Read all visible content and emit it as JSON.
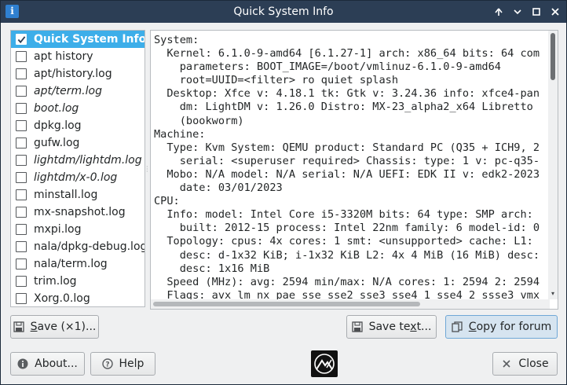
{
  "window": {
    "title": "Quick System Info",
    "app_icon_glyph": "i"
  },
  "file_list": {
    "items": [
      {
        "label": "Quick System Info",
        "checked": true,
        "selected": true,
        "italic": false
      },
      {
        "label": "apt history",
        "checked": false,
        "selected": false,
        "italic": false
      },
      {
        "label": "apt/history.log",
        "checked": false,
        "selected": false,
        "italic": false
      },
      {
        "label": "apt/term.log",
        "checked": false,
        "selected": false,
        "italic": true
      },
      {
        "label": "boot.log",
        "checked": false,
        "selected": false,
        "italic": true
      },
      {
        "label": "dpkg.log",
        "checked": false,
        "selected": false,
        "italic": false
      },
      {
        "label": "gufw.log",
        "checked": false,
        "selected": false,
        "italic": false
      },
      {
        "label": "lightdm/lightdm.log",
        "checked": false,
        "selected": false,
        "italic": true
      },
      {
        "label": "lightdm/x-0.log",
        "checked": false,
        "selected": false,
        "italic": true
      },
      {
        "label": "minstall.log",
        "checked": false,
        "selected": false,
        "italic": false
      },
      {
        "label": "mx-snapshot.log",
        "checked": false,
        "selected": false,
        "italic": false
      },
      {
        "label": "mxpi.log",
        "checked": false,
        "selected": false,
        "italic": false
      },
      {
        "label": "nala/dpkg-debug.log",
        "checked": false,
        "selected": false,
        "italic": false
      },
      {
        "label": "nala/term.log",
        "checked": false,
        "selected": false,
        "italic": false
      },
      {
        "label": "trim.log",
        "checked": false,
        "selected": false,
        "italic": false
      },
      {
        "label": "Xorg.0.log",
        "checked": false,
        "selected": false,
        "italic": false
      }
    ]
  },
  "info_text": "System:\n  Kernel: 6.1.0-9-amd64 [6.1.27-1] arch: x86_64 bits: 64 com\n    parameters: BOOT_IMAGE=/boot/vmlinuz-6.1.0-9-amd64\n    root=UUID=<filter> ro quiet splash\n  Desktop: Xfce v: 4.18.1 tk: Gtk v: 3.24.36 info: xfce4-pan\n    dm: LightDM v: 1.26.0 Distro: MX-23_alpha2_x64 Libretto\n    (bookworm)\nMachine:\n  Type: Kvm System: QEMU product: Standard PC (Q35 + ICH9, 2\n    serial: <superuser required> Chassis: type: 1 v: pc-q35-\n  Mobo: N/A model: N/A serial: N/A UEFI: EDK II v: edk2-2023\n    date: 03/01/2023\nCPU:\n  Info: model: Intel Core i5-3320M bits: 64 type: SMP arch:\n    built: 2012-15 process: Intel 22nm family: 6 model-id: 0\n  Topology: cpus: 4x cores: 1 smt: <unsupported> cache: L1:\n    desc: d-1x32 KiB; i-1x32 KiB L2: 4x 4 MiB (16 MiB) desc:\n    desc: 1x16 MiB\n  Speed (MHz): avg: 2594 min/max: N/A cores: 1: 2594 2: 2594\n  Flags: avx lm nx pae sse sse2 sse3 sse4_1 sse4_2 ssse3 vmx",
  "buttons": {
    "save_x1_prefix": "S",
    "save_x1_rest": "ave (×1)...",
    "save_text_prefix": "Save te",
    "save_text_underline": "x",
    "save_text_rest": "t...",
    "copy_forum_prefix": "",
    "copy_forum_underline": "C",
    "copy_forum_rest": "opy for forum",
    "about": "About...",
    "help": "Help",
    "close": "Close"
  },
  "icons": {
    "app": "info-icon",
    "save": "floppy-icon",
    "copy": "copy-icon",
    "about": "info-circle-icon",
    "help": "question-circle-icon",
    "close": "close-x-icon",
    "logo": "mx-linux-logo"
  },
  "colors": {
    "titlebar": "#2c3e55",
    "selection": "#3daee9",
    "window_bg": "#eff0f1"
  }
}
